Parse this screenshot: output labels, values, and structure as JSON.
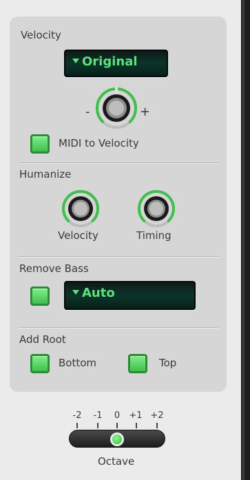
{
  "velocity": {
    "title": "Velocity",
    "dropdown_value": "Original",
    "knob_minus": "-",
    "knob_plus": "+",
    "midi_to_velocity_label": "MIDI to Velocity",
    "midi_to_velocity_checked": true
  },
  "humanize": {
    "title": "Humanize",
    "velocity_label": "Velocity",
    "timing_label": "Timing"
  },
  "remove_bass": {
    "title": "Remove Bass",
    "checked": true,
    "dropdown_value": "Auto"
  },
  "add_root": {
    "title": "Add Root",
    "bottom_label": "Bottom",
    "bottom_checked": true,
    "top_label": "Top",
    "top_checked": true
  },
  "octave": {
    "label": "Octave",
    "ticks": [
      "-2",
      "-1",
      "0",
      "+1",
      "+2"
    ],
    "value": "0"
  },
  "colors": {
    "accent_green": "#5fe07a",
    "panel_bg": "#d6d6d6",
    "page_bg": "#ebebeb"
  }
}
